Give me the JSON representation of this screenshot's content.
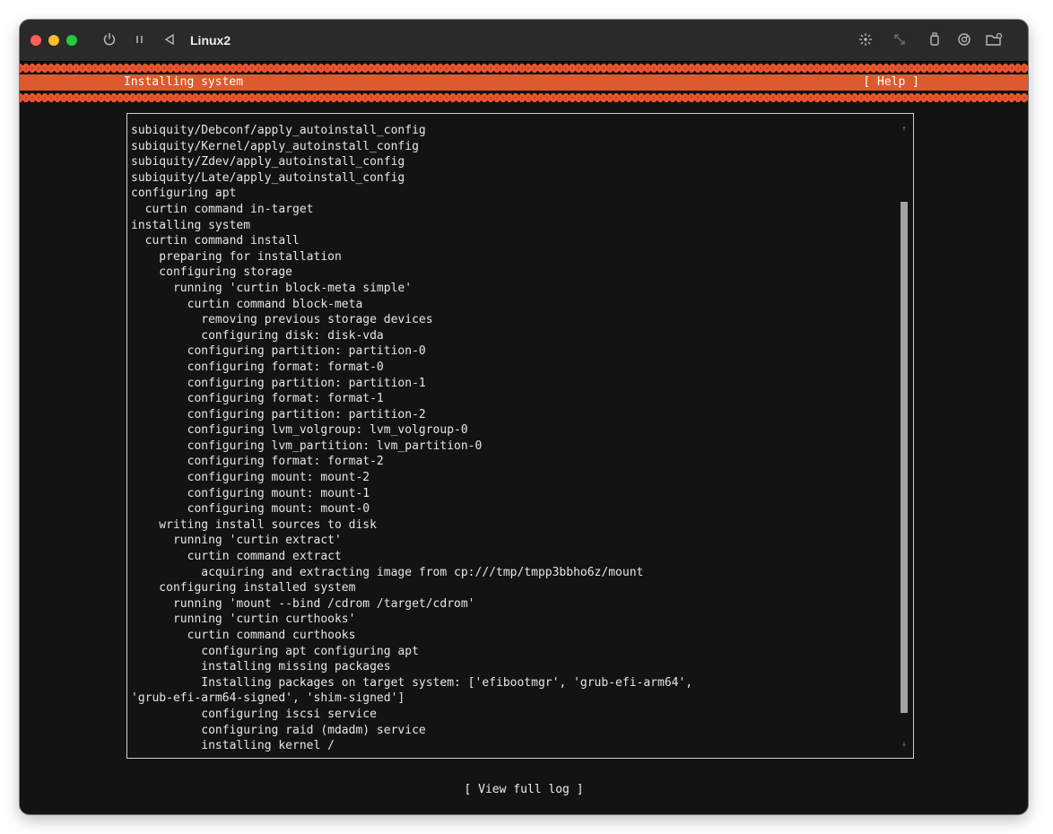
{
  "window": {
    "title": "Linux2",
    "icons": [
      "power-icon",
      "pause-icon",
      "back-icon",
      "brightness-icon",
      "resize-icon",
      "usb-icon",
      "network-icon",
      "folder-icon"
    ]
  },
  "header": {
    "title": "Installing system",
    "help_label": "[ Help ]"
  },
  "log": {
    "lines": [
      "subiquity/Debconf/apply_autoinstall_config",
      "subiquity/Kernel/apply_autoinstall_config",
      "subiquity/Zdev/apply_autoinstall_config",
      "subiquity/Late/apply_autoinstall_config",
      "configuring apt",
      "  curtin command in-target",
      "installing system",
      "  curtin command install",
      "    preparing for installation",
      "    configuring storage",
      "      running 'curtin block-meta simple'",
      "        curtin command block-meta",
      "          removing previous storage devices",
      "          configuring disk: disk-vda",
      "        configuring partition: partition-0",
      "        configuring format: format-0",
      "        configuring partition: partition-1",
      "        configuring format: format-1",
      "        configuring partition: partition-2",
      "        configuring lvm_volgroup: lvm_volgroup-0",
      "        configuring lvm_partition: lvm_partition-0",
      "        configuring format: format-2",
      "        configuring mount: mount-2",
      "        configuring mount: mount-1",
      "        configuring mount: mount-0",
      "    writing install sources to disk",
      "      running 'curtin extract'",
      "        curtin command extract",
      "          acquiring and extracting image from cp:///tmp/tmpp3bbho6z/mount",
      "    configuring installed system",
      "      running 'mount --bind /cdrom /target/cdrom'",
      "      running 'curtin curthooks'",
      "        curtin command curthooks",
      "          configuring apt configuring apt",
      "          installing missing packages",
      "          Installing packages on target system: ['efibootmgr', 'grub-efi-arm64',",
      "'grub-efi-arm64-signed', 'shim-signed']",
      "          configuring iscsi service",
      "          configuring raid (mdadm) service",
      "          installing kernel /"
    ],
    "scroll_up": "↑",
    "scroll_down": "↓"
  },
  "footer": {
    "view_log_label": "[ View full log ]"
  },
  "colors": {
    "accent": "#dd5a2e",
    "close": "#ff5f57",
    "minimize": "#febc2e",
    "zoom": "#28c840"
  }
}
